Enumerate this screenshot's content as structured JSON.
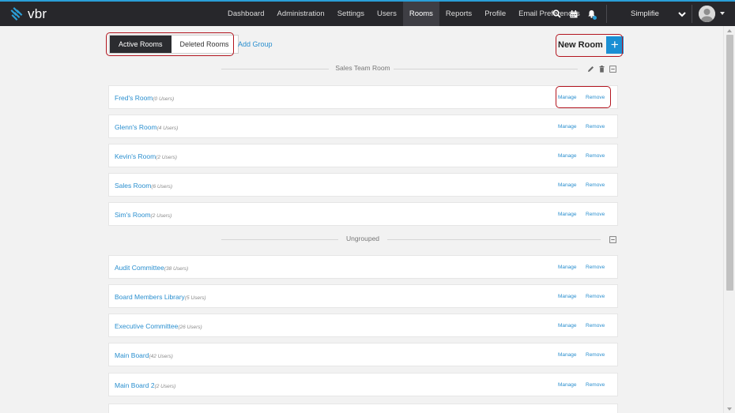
{
  "brand": {
    "name": "vbr",
    "accent": "#2a9fd8"
  },
  "nav": {
    "links": [
      {
        "label": "Dashboard",
        "active": false
      },
      {
        "label": "Administration",
        "active": false
      },
      {
        "label": "Settings",
        "active": false
      },
      {
        "label": "Users",
        "active": false
      },
      {
        "label": "Rooms",
        "active": true
      },
      {
        "label": "Reports",
        "active": false
      },
      {
        "label": "Profile",
        "active": false
      },
      {
        "label": "Email Preferences",
        "active": false
      }
    ],
    "icons": [
      "search-icon",
      "calendar-icon",
      "notification-bell-icon"
    ],
    "organization": "Simplifie"
  },
  "toolbar": {
    "tab_active": "Active Rooms",
    "tab_deleted": "Deleted Rooms",
    "add_group": "Add Group",
    "new_room": "New Room",
    "new_room_icon": "+"
  },
  "groups": [
    {
      "title": "Sales Team Room",
      "actions": [
        "pencil-icon",
        "trash-icon",
        "collapse-icon"
      ],
      "rooms": [
        {
          "name": "Fred's Room",
          "users": "(0 Users)"
        },
        {
          "name": "Glenn's Room",
          "users": "(4 Users)"
        },
        {
          "name": "Kevin's Room",
          "users": "(2 Users)"
        },
        {
          "name": "Sales Room",
          "users": "(6 Users)"
        },
        {
          "name": "Sim's Room",
          "users": "(2 Users)"
        }
      ]
    },
    {
      "title": "Ungrouped",
      "actions": [
        "collapse-icon"
      ],
      "rooms": [
        {
          "name": "Audit Committee",
          "users": "(38 Users)"
        },
        {
          "name": "Board Members Library",
          "users": "(5 Users)"
        },
        {
          "name": "Executive Committee",
          "users": "(26 Users)"
        },
        {
          "name": "Main Board",
          "users": "(42 Users)"
        },
        {
          "name": "Main Board 2",
          "users": "(2 Users)"
        }
      ]
    }
  ],
  "row_actions": {
    "manage": "Manage",
    "remove": "Remove"
  },
  "colors": {
    "link": "#2a8fcf",
    "navbar": "#27272b",
    "highlight": "#b3151f",
    "new_room_button": "#1a8fd4"
  }
}
